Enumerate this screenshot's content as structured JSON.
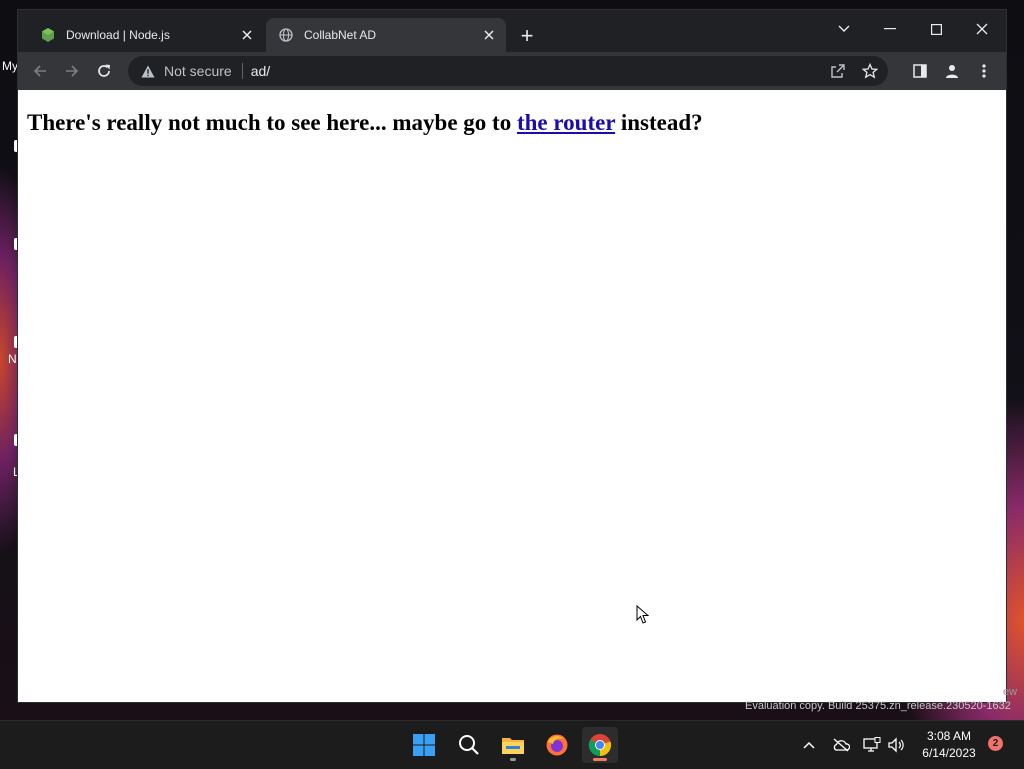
{
  "desktop": {
    "icon_label_my": "My",
    "icon_label_n": "N",
    "icon_label_l": "L"
  },
  "browser": {
    "tabs": [
      {
        "title": "Download | Node.js",
        "favicon": "nodejs-icon",
        "active": false
      },
      {
        "title": "CollabNet AD",
        "favicon": "globe-icon",
        "active": true
      }
    ],
    "new_tab_label": "+",
    "security_label": "Not secure",
    "url": "ad/"
  },
  "page": {
    "text_before": "There's really not much to see here... maybe go to ",
    "link_text": "the router",
    "text_after": " instead?"
  },
  "watermark": {
    "line": "Evaluation copy. Build 25375.zn_release.230520-1632",
    "partial": "ew"
  },
  "taskbar": {
    "apps": [
      "start-icon",
      "search-icon",
      "file-explorer-icon",
      "firefox-icon",
      "chrome-icon"
    ],
    "time": "3:08 AM",
    "date": "6/14/2023",
    "notification_count": "2"
  }
}
